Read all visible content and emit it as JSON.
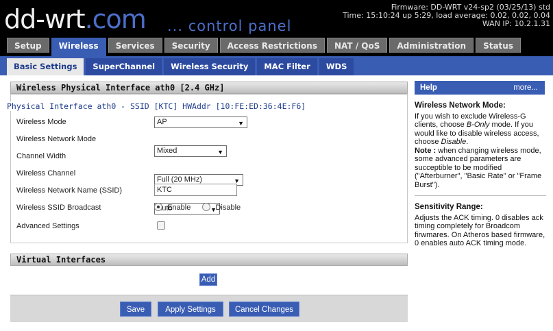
{
  "header": {
    "logo_main": "dd-wrt",
    "logo_com": ".com",
    "subtitle": "... control panel",
    "firmware": "Firmware: DD-WRT v24-sp2 (03/25/13) std",
    "time": "Time: 15:10:24 up 5:29, load average: 0.02, 0.02, 0.04",
    "wan_ip": "WAN IP: 10.2.1.31"
  },
  "tabs": [
    {
      "label": "Setup",
      "active": false
    },
    {
      "label": "Wireless",
      "active": true
    },
    {
      "label": "Services",
      "active": false
    },
    {
      "label": "Security",
      "active": false
    },
    {
      "label": "Access Restrictions",
      "active": false
    },
    {
      "label": "NAT / QoS",
      "active": false
    },
    {
      "label": "Administration",
      "active": false
    },
    {
      "label": "Status",
      "active": false
    }
  ],
  "subtabs": [
    {
      "label": "Basic Settings",
      "active": true
    },
    {
      "label": "SuperChannel",
      "active": false
    },
    {
      "label": "Wireless Security",
      "active": false
    },
    {
      "label": "MAC Filter",
      "active": false
    },
    {
      "label": "WDS",
      "active": false
    }
  ],
  "main": {
    "section_title": "Wireless Physical Interface ath0 [2.4 GHz]",
    "interface_title": "Physical Interface ath0 - SSID [KTC] HWAddr [10:FE:ED:36:4E:F6]",
    "fields": {
      "mode_label": "Wireless Mode",
      "mode_value": "AP",
      "network_mode_label": "Wireless Network Mode",
      "network_mode_value": "Mixed",
      "channel_width_label": "Channel Width",
      "channel_width_value": "Full (20 MHz)",
      "channel_label": "Wireless Channel",
      "channel_value": "Auto",
      "ssid_label": "Wireless Network Name (SSID)",
      "ssid_value": "KTC",
      "broadcast_label": "Wireless SSID Broadcast",
      "broadcast_enable": "Enable",
      "broadcast_disable": "Disable",
      "advanced_label": "Advanced Settings"
    },
    "virtual_title": "Virtual Interfaces",
    "add_label": "Add",
    "save_label": "Save",
    "apply_label": "Apply Settings",
    "cancel_label": "Cancel Changes"
  },
  "help": {
    "title": "Help",
    "more": "more...",
    "network_mode_heading": "Wireless Network Mode:",
    "network_mode_text1": "If you wish to exclude Wireless-G clients, choose ",
    "network_mode_em1": "B-Only",
    "network_mode_text2": " mode. If you would like to disable wireless access, choose ",
    "network_mode_em2": "Disable",
    "network_mode_text3": ".",
    "note_label": "Note :",
    "note_text": " when changing wireless mode, some advanced parameters are succeptible to be modified (\"Afterburner\", \"Basic Rate\" or \"Frame Burst\").",
    "sensitivity_heading": "Sensitivity Range:",
    "sensitivity_text": "Adjusts the ACK timing. 0 disables ack timing completely for Broadcom firwmares. On Atheros based firmware, 0 enables auto ACK timing mode."
  },
  "colors": {
    "accent": "#3a5db4",
    "header_bg": "#000000",
    "tab_inactive": "#6a6a6a"
  }
}
